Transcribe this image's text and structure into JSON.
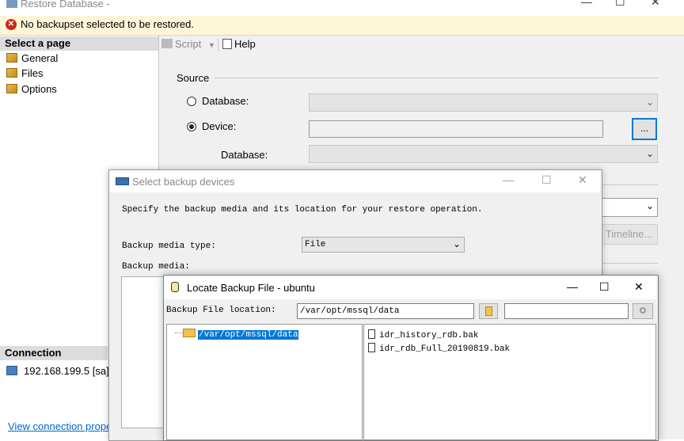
{
  "main_window": {
    "title": "Restore Database -",
    "error_message": "No backupset selected to be restored.",
    "minimize": "—",
    "maximize": "☐",
    "close": "✕"
  },
  "left_pane": {
    "select_page_header": "Select a page",
    "pages": [
      {
        "label": "General"
      },
      {
        "label": "Files"
      },
      {
        "label": "Options"
      }
    ],
    "connection_header": "Connection",
    "connection_value": "192.168.199.5 [sa]",
    "view_connection_link": "View connection prope"
  },
  "toolbar": {
    "script_label": "Script",
    "help_label": "Help"
  },
  "source": {
    "group_label": "Source",
    "database_radio_label": "Database:",
    "device_radio_label": "Device:",
    "selected_radio": "device",
    "device_browse_label": "...",
    "database_label": "Database:",
    "timeline_label": "Timeline..."
  },
  "select_backup_devices": {
    "title": "Select backup devices",
    "instructions": "Specify the backup media and its location for your restore operation.",
    "media_type_label": "Backup media type:",
    "media_type_value": "File",
    "backup_media_label": "Backup media:"
  },
  "locate_backup_file": {
    "title": "Locate Backup File - ubuntu",
    "location_label": "Backup File location:",
    "location_value": "/var/opt/mssql/data",
    "search_placeholder": "",
    "tree": [
      {
        "label": "/var/opt/mssql/data",
        "selected": true
      }
    ],
    "files": [
      {
        "name": "idr_history_rdb.bak"
      },
      {
        "name": "idr_rdb_Full_20190819.bak"
      }
    ]
  },
  "colors": {
    "error_bar": "#fdf6d8",
    "error_icon": "#c42b1c",
    "selection": "#0078d7",
    "link": "#0066cc"
  }
}
